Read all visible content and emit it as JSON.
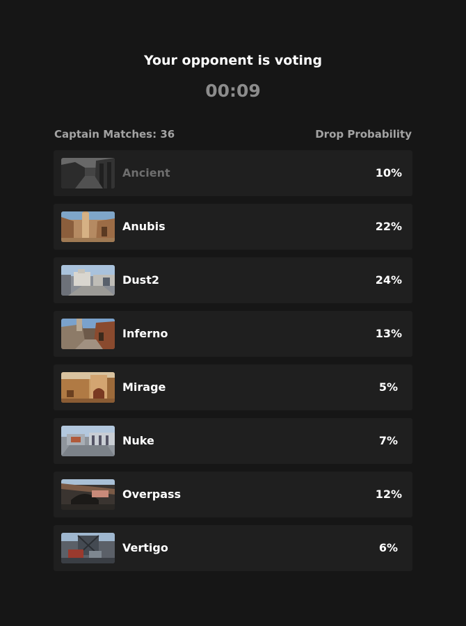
{
  "status": {
    "title": "Your opponent is voting",
    "timer": "00:09"
  },
  "list_header": {
    "captain_matches": "Captain Matches: 36",
    "drop_probability": "Drop Probability"
  },
  "maps": [
    {
      "name": "Ancient",
      "probability": "10%",
      "thumbnail": "ancient-thumbnail",
      "state": "dimmed"
    },
    {
      "name": "Anubis",
      "probability": "22%",
      "thumbnail": "anubis-thumbnail",
      "state": "available"
    },
    {
      "name": "Dust2",
      "probability": "24%",
      "thumbnail": "dust2-thumbnail",
      "state": "available"
    },
    {
      "name": "Inferno",
      "probability": "13%",
      "thumbnail": "inferno-thumbnail",
      "state": "available"
    },
    {
      "name": "Mirage",
      "probability": "5%",
      "thumbnail": "mirage-thumbnail",
      "state": "available"
    },
    {
      "name": "Nuke",
      "probability": "7%",
      "thumbnail": "nuke-thumbnail",
      "state": "available"
    },
    {
      "name": "Overpass",
      "probability": "12%",
      "thumbnail": "overpass-thumbnail",
      "state": "available"
    },
    {
      "name": "Vertigo",
      "probability": "6%",
      "thumbnail": "vertigo-thumbnail",
      "state": "available"
    }
  ],
  "colors": {
    "background": "#161616",
    "row_background": "#1f1f1f",
    "text_primary": "#ffffff",
    "text_muted": "#a3a3a3",
    "timer": "#8c8c8c",
    "dimmed_text": "#6e6e6e"
  }
}
